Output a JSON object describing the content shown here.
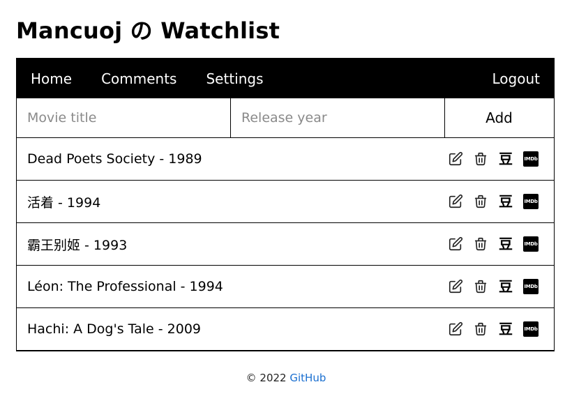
{
  "header": {
    "title": "Mancuoj の Watchlist"
  },
  "nav": {
    "home": "Home",
    "comments": "Comments",
    "settings": "Settings",
    "logout": "Logout"
  },
  "form": {
    "title_placeholder": "Movie title",
    "year_placeholder": "Release year",
    "add_label": "Add"
  },
  "icons": {
    "edit": "edit-icon",
    "delete": "trash-icon",
    "douban": "豆",
    "imdb": "IMDb"
  },
  "movies": [
    {
      "label": "Dead Poets Society - 1989"
    },
    {
      "label": "活着 - 1994"
    },
    {
      "label": "霸王别姬 - 1993"
    },
    {
      "label": "Léon: The Professional - 1994"
    },
    {
      "label": "Hachi: A Dog's Tale - 2009"
    }
  ],
  "footer": {
    "copyright": "© 2022",
    "link": "GitHub"
  }
}
